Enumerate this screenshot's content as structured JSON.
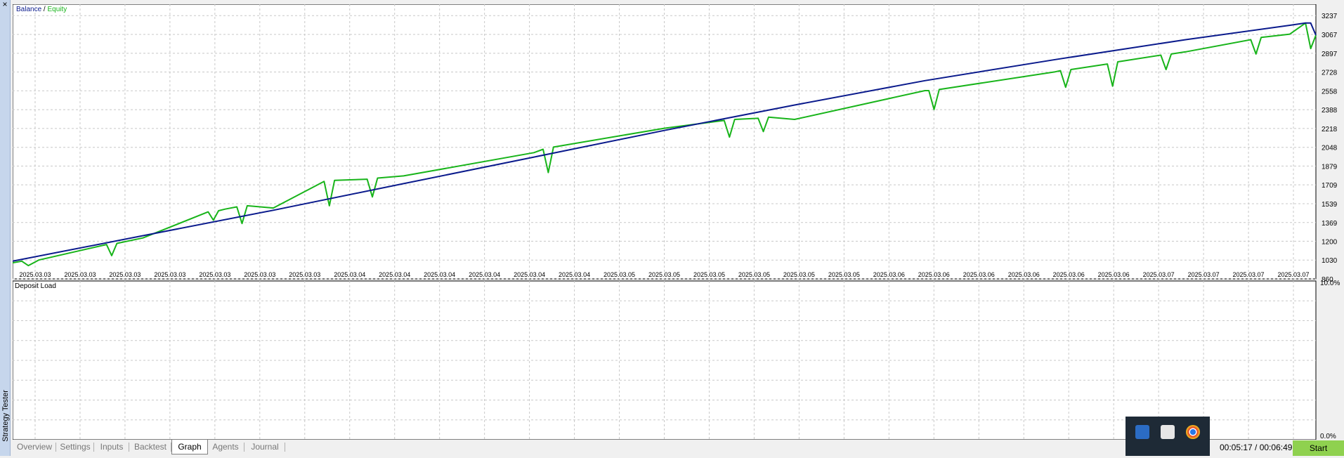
{
  "sidebar": {
    "title": "Strategy Tester",
    "close_label": "×"
  },
  "colors": {
    "balance": "#0a1a8c",
    "equity": "#18b41a",
    "deposit_bar": "#18b41a",
    "grid": "#c8c8c8",
    "start_button": "#8fd14f"
  },
  "chart_data": [
    {
      "type": "line",
      "legend": [
        "Balance",
        "Equity"
      ],
      "legend_separator": " / ",
      "legend_placement": "top-left",
      "grid": true,
      "y_ticks": [
        860,
        1030,
        1200,
        1369,
        1539,
        1709,
        1879,
        2048,
        2218,
        2388,
        2558,
        2728,
        2897,
        3067,
        3237
      ],
      "ylim": [
        860,
        3340
      ],
      "x_tick_labels": [
        "2025.03.03",
        "2025.03.03",
        "2025.03.03",
        "2025.03.03",
        "2025.03.03",
        "2025.03.03",
        "2025.03.03",
        "2025.03.04",
        "2025.03.04",
        "2025.03.04",
        "2025.03.04",
        "2025.03.04",
        "2025.03.04",
        "2025.03.05",
        "2025.03.05",
        "2025.03.05",
        "2025.03.05",
        "2025.03.05",
        "2025.03.05",
        "2025.03.06",
        "2025.03.06",
        "2025.03.06",
        "2025.03.06",
        "2025.03.06",
        "2025.03.06",
        "2025.03.07",
        "2025.03.07",
        "2025.03.07",
        "2025.03.07"
      ],
      "x_range_index": [
        0,
        100
      ],
      "series": [
        {
          "name": "Balance",
          "x": [
            0,
            10,
            20,
            30,
            40,
            50,
            60,
            70,
            80,
            90,
            98,
            99.2,
            99.6,
            100
          ],
          "values": [
            1020,
            1250,
            1480,
            1720,
            1960,
            2200,
            2430,
            2650,
            2840,
            3020,
            3150,
            3170,
            3170,
            3060
          ]
        },
        {
          "name": "Equity",
          "x": [
            0,
            0.7,
            1.2,
            2,
            7.2,
            7.6,
            8,
            10,
            15,
            15.4,
            15.8,
            16.3,
            17.2,
            17.6,
            18,
            20,
            23.9,
            24.3,
            24.7,
            27.2,
            27.6,
            28,
            30,
            40,
            40.7,
            41.1,
            41.5,
            50,
            54.6,
            55,
            55.4,
            57.2,
            57.6,
            58,
            60,
            70,
            70.3,
            70.7,
            71.1,
            80,
            80.4,
            80.8,
            81.2,
            84,
            84.4,
            84.8,
            88.1,
            88.5,
            88.9,
            90,
            95,
            95.4,
            95.8,
            98,
            99.2,
            99.6,
            100
          ],
          "values": [
            1005,
            1020,
            980,
            1030,
            1170,
            1070,
            1180,
            1230,
            1465,
            1390,
            1475,
            1490,
            1510,
            1360,
            1520,
            1500,
            1740,
            1520,
            1750,
            1760,
            1600,
            1770,
            1790,
            2000,
            2030,
            1820,
            2050,
            2220,
            2290,
            2140,
            2300,
            2310,
            2190,
            2320,
            2300,
            2560,
            2560,
            2390,
            2570,
            2730,
            2740,
            2590,
            2750,
            2800,
            2600,
            2820,
            2880,
            2750,
            2890,
            2910,
            3020,
            2890,
            3040,
            3070,
            3170,
            2940,
            3060
          ]
        }
      ]
    },
    {
      "type": "bar",
      "title": "Deposit Load",
      "y_ticks": [
        "10.0%",
        "0.0%"
      ],
      "ylim": [
        0,
        10
      ],
      "x_range_index": [
        0,
        100
      ],
      "series": [
        {
          "name": "Deposit Load",
          "x": [],
          "values": []
        }
      ]
    }
  ],
  "tabs": [
    {
      "label": "Overview"
    },
    {
      "label": "Settings"
    },
    {
      "label": "Inputs"
    },
    {
      "label": "Backtest"
    },
    {
      "label": "Graph",
      "active": true
    },
    {
      "label": "Agents"
    },
    {
      "label": "Journal"
    }
  ],
  "timer": "00:05:17 / 00:06:49",
  "start_label": "Start",
  "tray_icons": [
    "app-grid-icon",
    "shield-icon",
    "chrome-icon"
  ]
}
